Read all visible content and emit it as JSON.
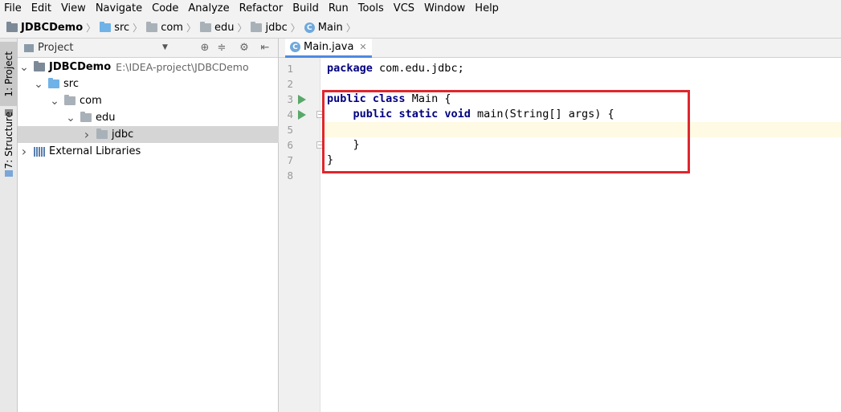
{
  "menu": [
    "File",
    "Edit",
    "View",
    "Navigate",
    "Code",
    "Analyze",
    "Refactor",
    "Build",
    "Run",
    "Tools",
    "VCS",
    "Window",
    "Help"
  ],
  "breadcrumb": [
    {
      "label": "JDBCDemo",
      "icon": "project-folder-icon"
    },
    {
      "label": "src",
      "icon": "source-folder-icon"
    },
    {
      "label": "com",
      "icon": "package-folder-icon"
    },
    {
      "label": "edu",
      "icon": "package-folder-icon"
    },
    {
      "label": "jdbc",
      "icon": "package-folder-icon"
    },
    {
      "label": "Main",
      "icon": "class-icon"
    }
  ],
  "toolstrip": {
    "project_tab": "1: Project",
    "structure_tab": "7: Structure"
  },
  "project_panel": {
    "title": "Project",
    "tree": [
      {
        "label": "JDBCDemo",
        "path": "E:\\IDEA-project\\JDBCDemo",
        "expanded": true,
        "icon": "project-folder-icon"
      },
      {
        "label": "src",
        "expanded": true,
        "icon": "source-folder-icon"
      },
      {
        "label": "com",
        "expanded": true,
        "icon": "package-folder-icon"
      },
      {
        "label": "edu",
        "expanded": true,
        "icon": "package-folder-icon"
      },
      {
        "label": "jdbc",
        "expanded": false,
        "selected": true,
        "icon": "package-folder-icon"
      },
      {
        "label": "External Libraries",
        "expanded": false,
        "icon": "libraries-icon"
      }
    ]
  },
  "editor": {
    "tab": {
      "label": "Main.java",
      "icon": "class-icon"
    },
    "line_numbers": [
      "1",
      "2",
      "3",
      "4",
      "5",
      "6",
      "7",
      "8"
    ],
    "lines": [
      [
        {
          "t": "package",
          "k": true
        },
        {
          "t": " com.edu.jdbc;"
        }
      ],
      [],
      [
        {
          "t": "public",
          "k": true
        },
        {
          "t": " "
        },
        {
          "t": "class",
          "k": true
        },
        {
          "t": " Main {"
        }
      ],
      [
        {
          "t": "    "
        },
        {
          "t": "public",
          "k": true
        },
        {
          "t": " "
        },
        {
          "t": "static",
          "k": true
        },
        {
          "t": " "
        },
        {
          "t": "void",
          "k": true
        },
        {
          "t": " main(String[] args) {"
        }
      ],
      [],
      [
        {
          "t": "    }"
        }
      ],
      [
        {
          "t": "}"
        }
      ],
      []
    ],
    "current_line": 5
  },
  "colors": {
    "keyword": "#000080",
    "run_icon": "#59a869",
    "highlight_box": "#e0262d",
    "current_line_bg": "#fffae3"
  }
}
